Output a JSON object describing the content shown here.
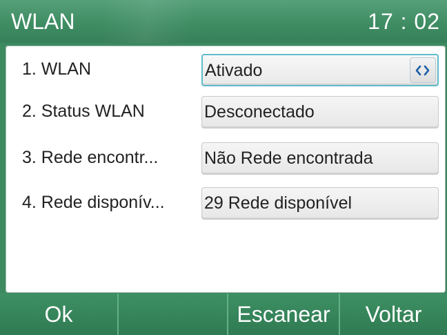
{
  "header": {
    "title": "WLAN",
    "time": "17 : 02"
  },
  "rows": [
    {
      "label": "1.  WLAN",
      "value": "Ativado",
      "has_switch": true
    },
    {
      "label": "2.  Status WLAN",
      "value": "Desconectado"
    },
    {
      "label": "3.  Rede encontr...",
      "value": "Não Rede encontrada"
    },
    {
      "label": "4.  Rede disponív...",
      "value": "29 Rede disponível"
    }
  ],
  "softkeys": [
    "Ok",
    "",
    "Escanear",
    "Voltar"
  ],
  "colors": {
    "header_green": "#3f8d63",
    "focus_border": "#5fbcc9",
    "switch_arrows": "#1f5fa8"
  }
}
